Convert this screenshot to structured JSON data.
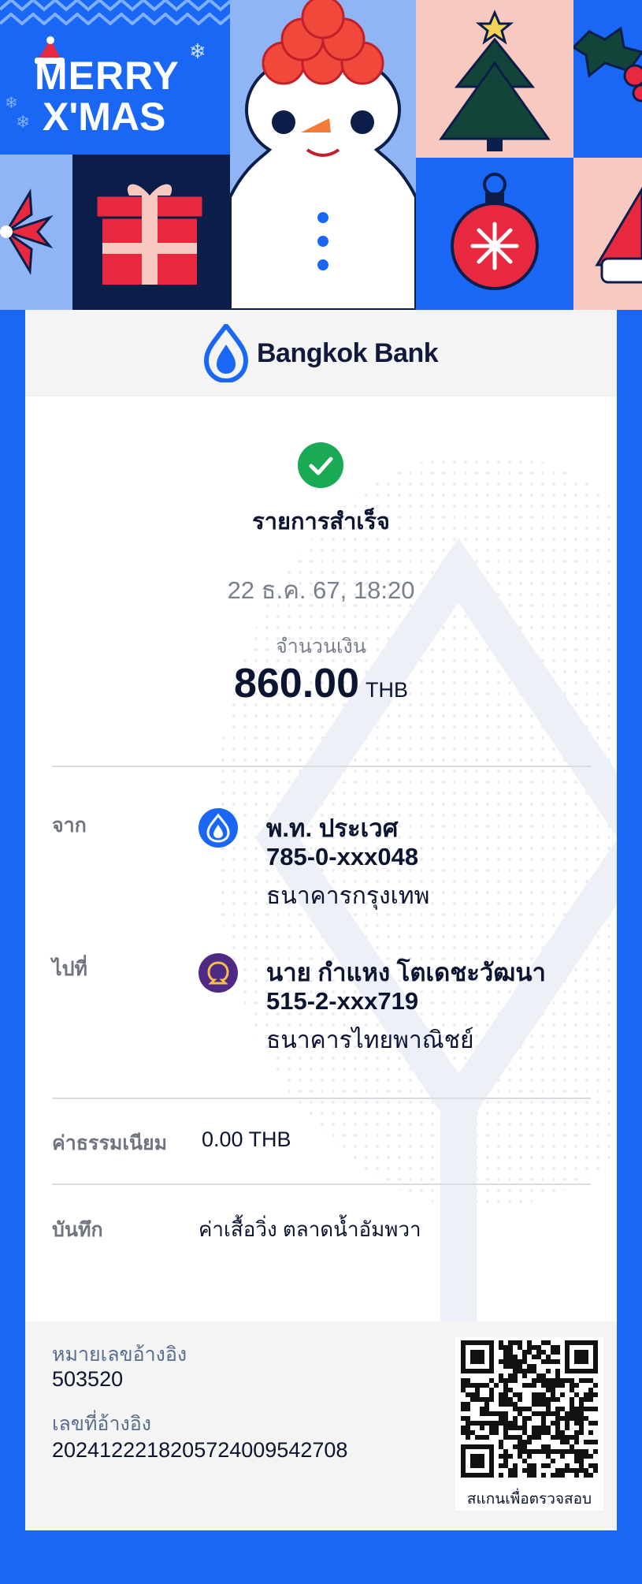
{
  "banner": {
    "greeting_line1": "MERRY",
    "greeting_line2": "X'MAS"
  },
  "bank": {
    "name": "Bangkok Bank"
  },
  "transaction": {
    "status": "รายการสำเร็จ",
    "datetime": "22 ธ.ค. 67, 18:20",
    "amount_label": "จำนวนเงิน",
    "amount": "860.00",
    "currency": "THB"
  },
  "from": {
    "label": "จาก",
    "name": "พ.ท. ประเวศ",
    "account": "785-0-xxx048",
    "bank": "ธนาคารกรุงเทพ"
  },
  "to": {
    "label": "ไปที่",
    "name": "นาย กำแหง โตเดชะวัฒนา",
    "account": "515-2-xxx719",
    "bank": "ธนาคารไทยพาณิชย์"
  },
  "fee": {
    "label": "ค่าธรรมเนียม",
    "value": "0.00 THB"
  },
  "memo": {
    "label": "บันทึก",
    "value": "ค่าเสื้อวิ่ง ตลาดน้ำอัมพวา"
  },
  "reference": {
    "ref_label": "หมายเลขอ้างอิง",
    "ref_value": "503520",
    "ref_no_label": "เลขที่อ้างอิง",
    "ref_no_value": "20241222182057240095427​08",
    "qr_caption": "สแกนเพื่อตรวจสอบ"
  },
  "colors": {
    "brand_blue": "#1a66f5",
    "success_green": "#1aaa55",
    "scb_purple": "#4e2a84"
  }
}
